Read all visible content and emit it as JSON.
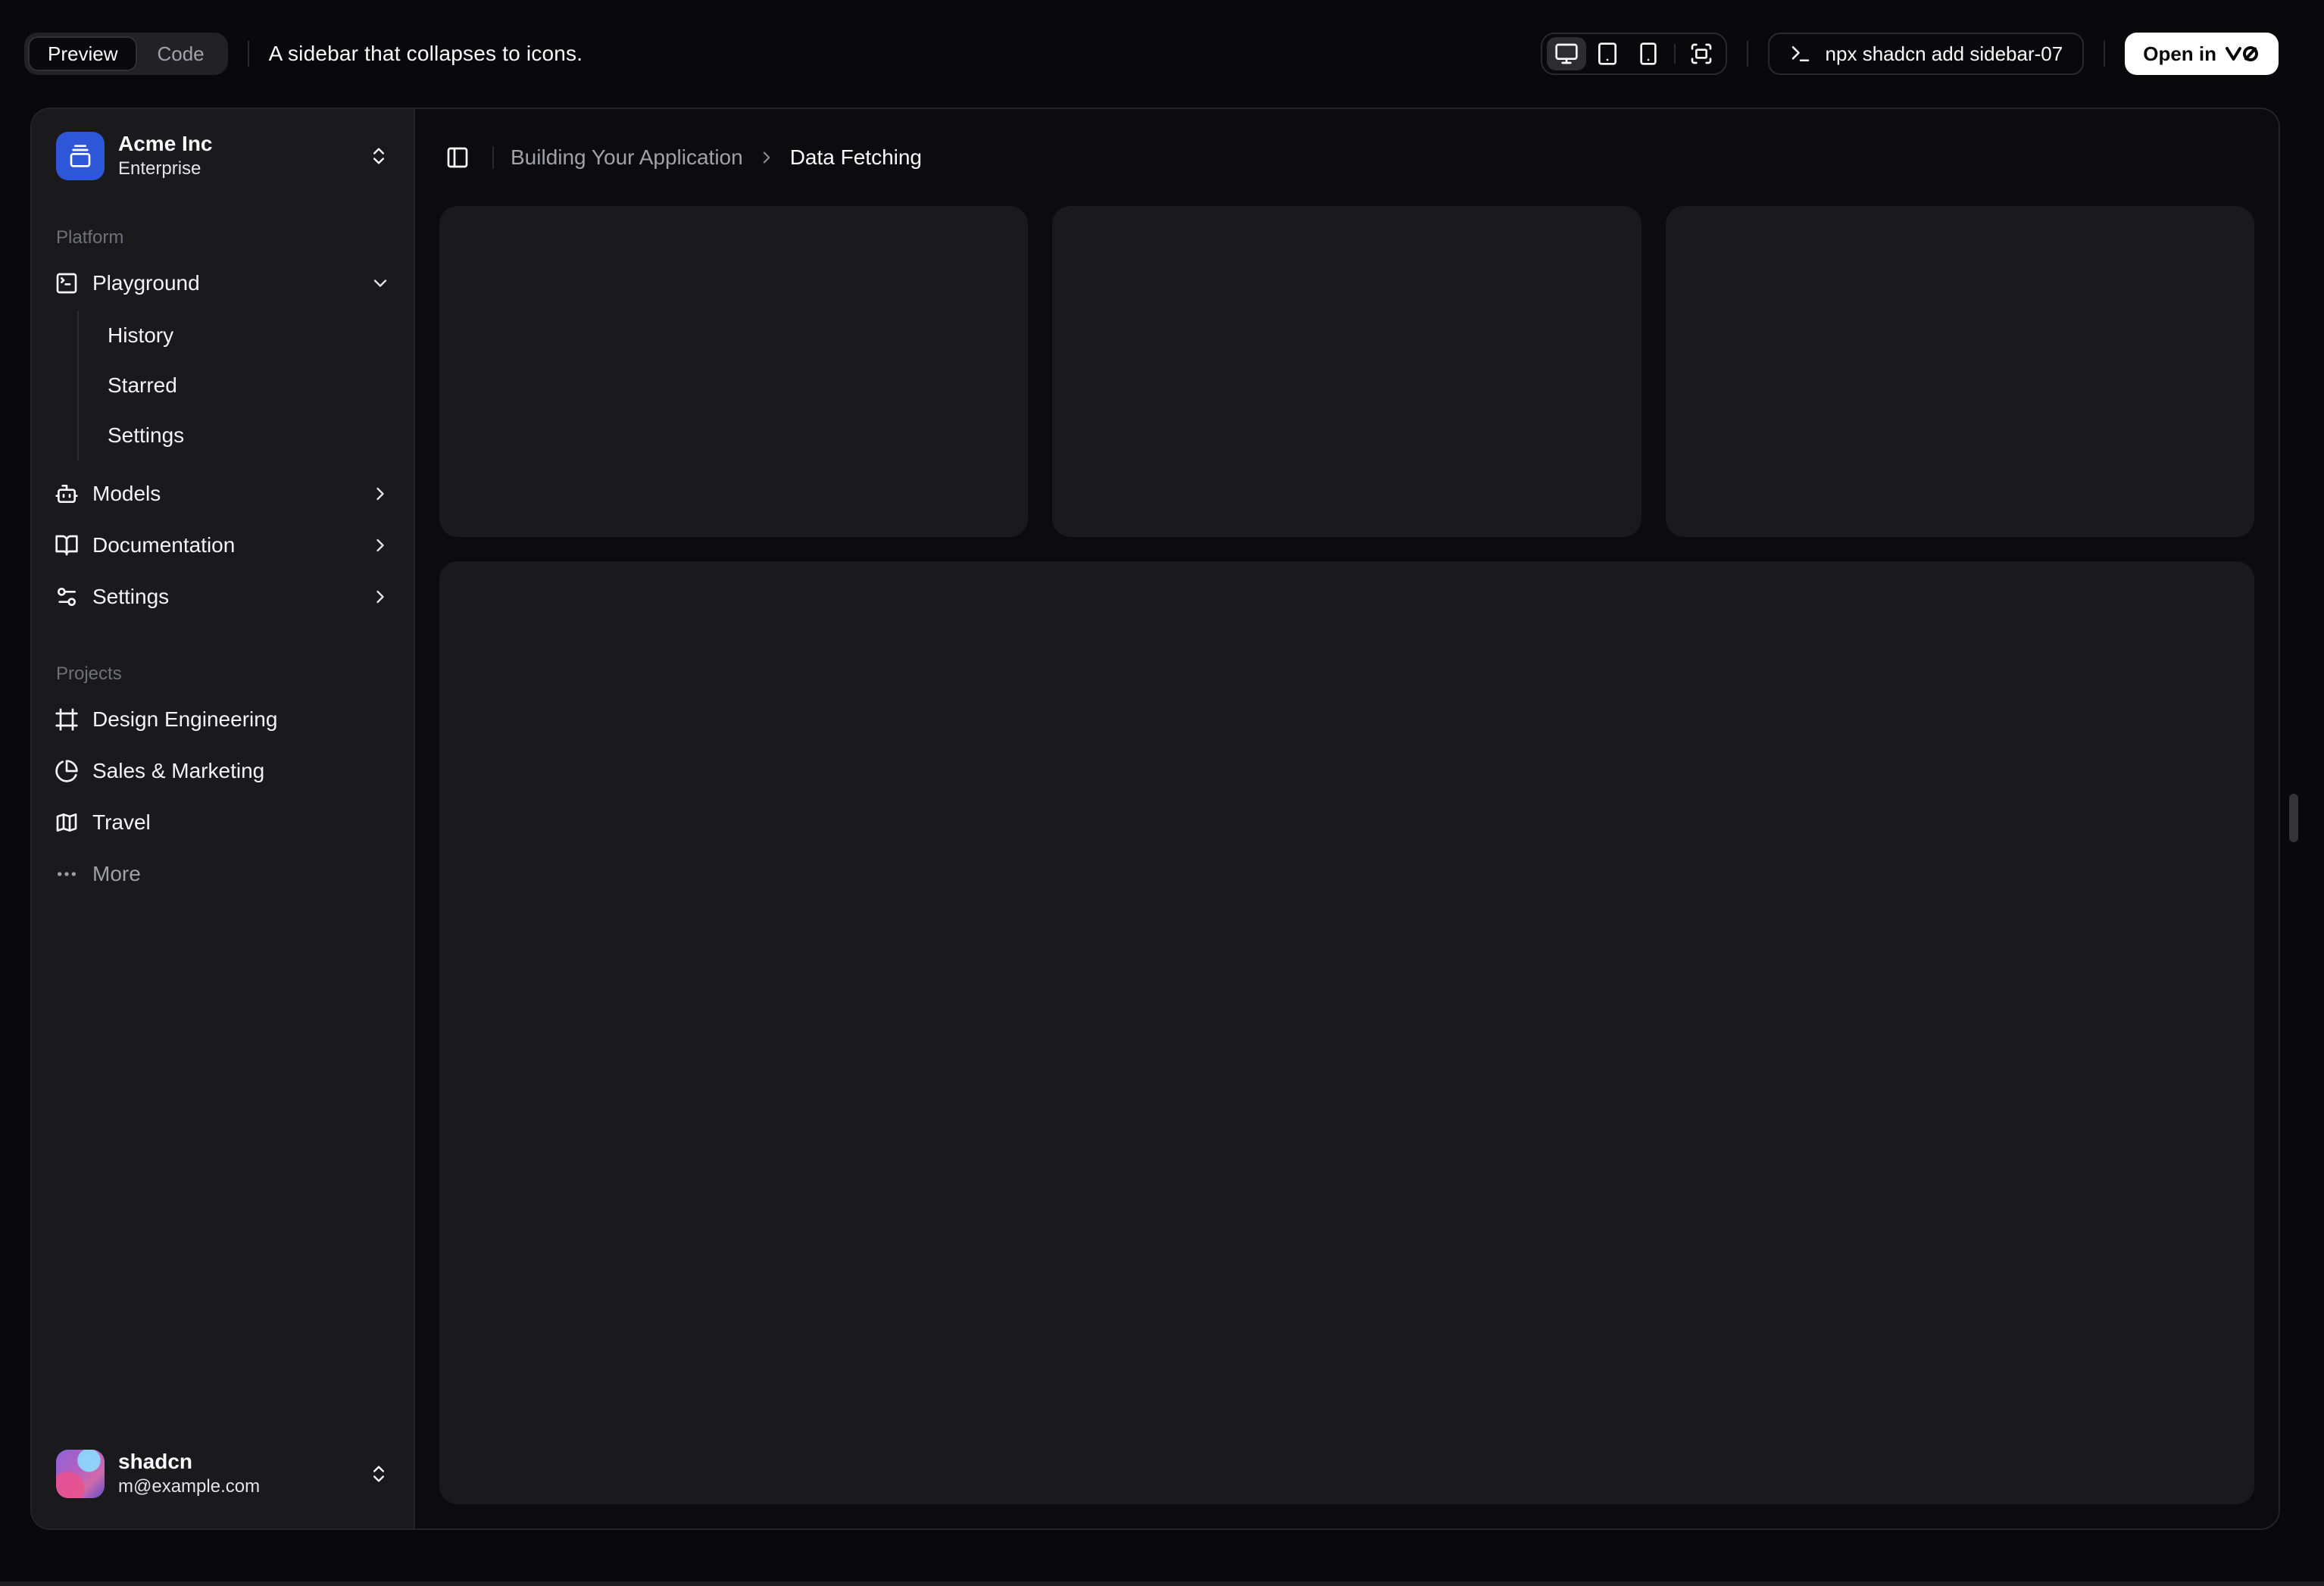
{
  "header": {
    "tabs": [
      {
        "label": "Preview",
        "active": true
      },
      {
        "label": "Code",
        "active": false
      }
    ],
    "description": "A sidebar that collapses to icons.",
    "device_icons": [
      "monitor-icon",
      "tablet-icon",
      "smartphone-icon",
      "fullscreen-icon"
    ],
    "active_device": "monitor",
    "command": "npx shadcn add sidebar-07",
    "open_in_label": "Open in",
    "open_in_icon": "v0-logo"
  },
  "sidebar": {
    "team": {
      "name": "Acme Inc",
      "plan": "Enterprise",
      "logo_icon": "gallery-vertical-end-icon"
    },
    "groups": [
      {
        "label": "Platform",
        "items": [
          {
            "label": "Playground",
            "icon": "square-terminal-icon",
            "expanded": true,
            "children": [
              {
                "label": "History"
              },
              {
                "label": "Starred"
              },
              {
                "label": "Settings"
              }
            ]
          },
          {
            "label": "Models",
            "icon": "bot-icon"
          },
          {
            "label": "Documentation",
            "icon": "book-open-icon"
          },
          {
            "label": "Settings",
            "icon": "settings-icon"
          }
        ]
      },
      {
        "label": "Projects",
        "items": [
          {
            "label": "Design Engineering",
            "icon": "frame-icon"
          },
          {
            "label": "Sales & Marketing",
            "icon": "pie-chart-icon"
          },
          {
            "label": "Travel",
            "icon": "map-icon"
          },
          {
            "label": "More",
            "icon": "ellipsis-icon",
            "muted": true
          }
        ]
      }
    ],
    "user": {
      "name": "shadcn",
      "email": "m@example.com"
    }
  },
  "main": {
    "breadcrumb": {
      "parent": "Building Your Application",
      "current": "Data Fetching"
    },
    "placeholder_cards": 3
  },
  "colors": {
    "page_bg": "#09090b",
    "panel_bg": "#0c0c0e",
    "surface": "#1a1a1d",
    "border": "#29292e",
    "accent_blue": "#2e56d8",
    "open_in_bg": "#ffffff",
    "muted_text": "#a1a1aa"
  }
}
